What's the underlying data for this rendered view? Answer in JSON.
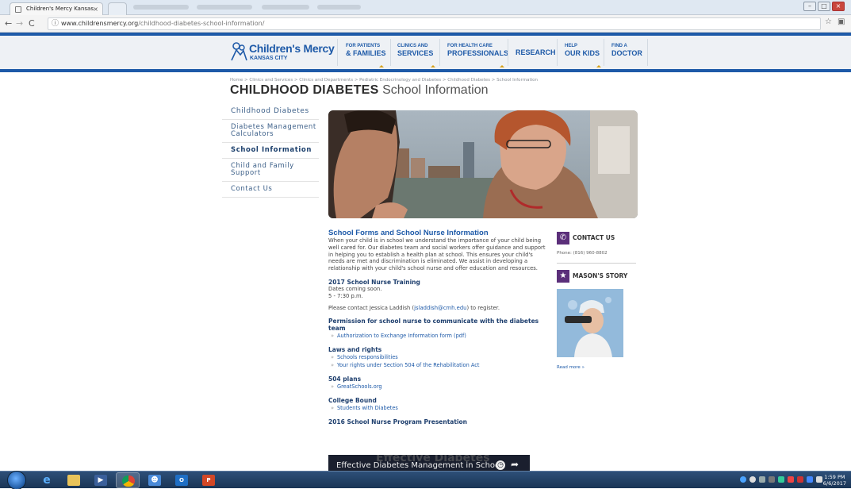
{
  "browser": {
    "tab_title": "Children's Mercy Kansas",
    "url_domain": "www.childrensmercy.org",
    "url_path": "/childhood-diabetes-school-information/"
  },
  "site": {
    "logo_name": "Children's Mercy",
    "logo_sub": "KANSAS CITY",
    "nav": [
      {
        "l1": "FOR PATIENTS",
        "l2": "& FAMILIES"
      },
      {
        "l1": "CLINICS AND",
        "l2": "SERVICES"
      },
      {
        "l1": "FOR HEALTH CARE",
        "l2": "PROFESSIONALS"
      },
      {
        "label": "RESEARCH"
      },
      {
        "l1": "HELP",
        "l2": "OUR KIDS"
      },
      {
        "l1": "FIND A",
        "l2": "DOCTOR"
      }
    ]
  },
  "page": {
    "breadcrumb": "Home > Clinics and Services > Clinics and Departments > Pediatric Endocrinology and Diabetes > Childhood Diabetes > School Information",
    "title_bold": "CHILDHOOD DIABETES",
    "title_light": "School Information"
  },
  "sidenav": [
    "Childhood Diabetes",
    "Diabetes Management Calculators",
    "School Information",
    "Child and Family Support",
    "Contact Us"
  ],
  "main": {
    "section_title": "School Forms and School Nurse Information",
    "intro": "When your child is in school we understand the importance of your child being well cared for. Our diabetes team and social workers offer guidance and support in helping you to establish a health plan at school. This ensures your child's needs are met and discrimination is eliminated. We assist in developing a relationship with your child's school nurse and offer education and resources.",
    "training_title": "2017 School Nurse Training",
    "training_line1": "Dates coming soon.",
    "training_line2": "5 - 7:30 p.m.",
    "contact_prefix": "Please contact Jessica Laddish (",
    "contact_email": "jsladdish@cmh.edu",
    "contact_suffix": ") to register.",
    "permission_title": "Permission for school nurse to communicate with the diabetes team",
    "permission_link": "Authorization to Exchange Information form (pdf)",
    "laws_title": "Laws and rights",
    "laws_link1": "Schools responsibilities",
    "laws_link2": "Your rights under Section 504 of the Rehabilitation Act",
    "plans_title": "504 plans",
    "plans_link": "GreatSchools.org",
    "college_title": "College Bound",
    "college_link": "Students with Diabetes",
    "presentation_title": "2016 School Nurse Program Presentation",
    "video_title": "Effective Diabetes Management in School",
    "video_bg_text": "Effective Diabetes"
  },
  "right": {
    "contact_head": "CONTACT US",
    "phone": "Phone: (816) 960-8802",
    "story_head": "MASON'S STORY",
    "read_more": "Read more »"
  },
  "taskbar": {
    "time": "1:59 PM",
    "date": "6/6/2017"
  }
}
